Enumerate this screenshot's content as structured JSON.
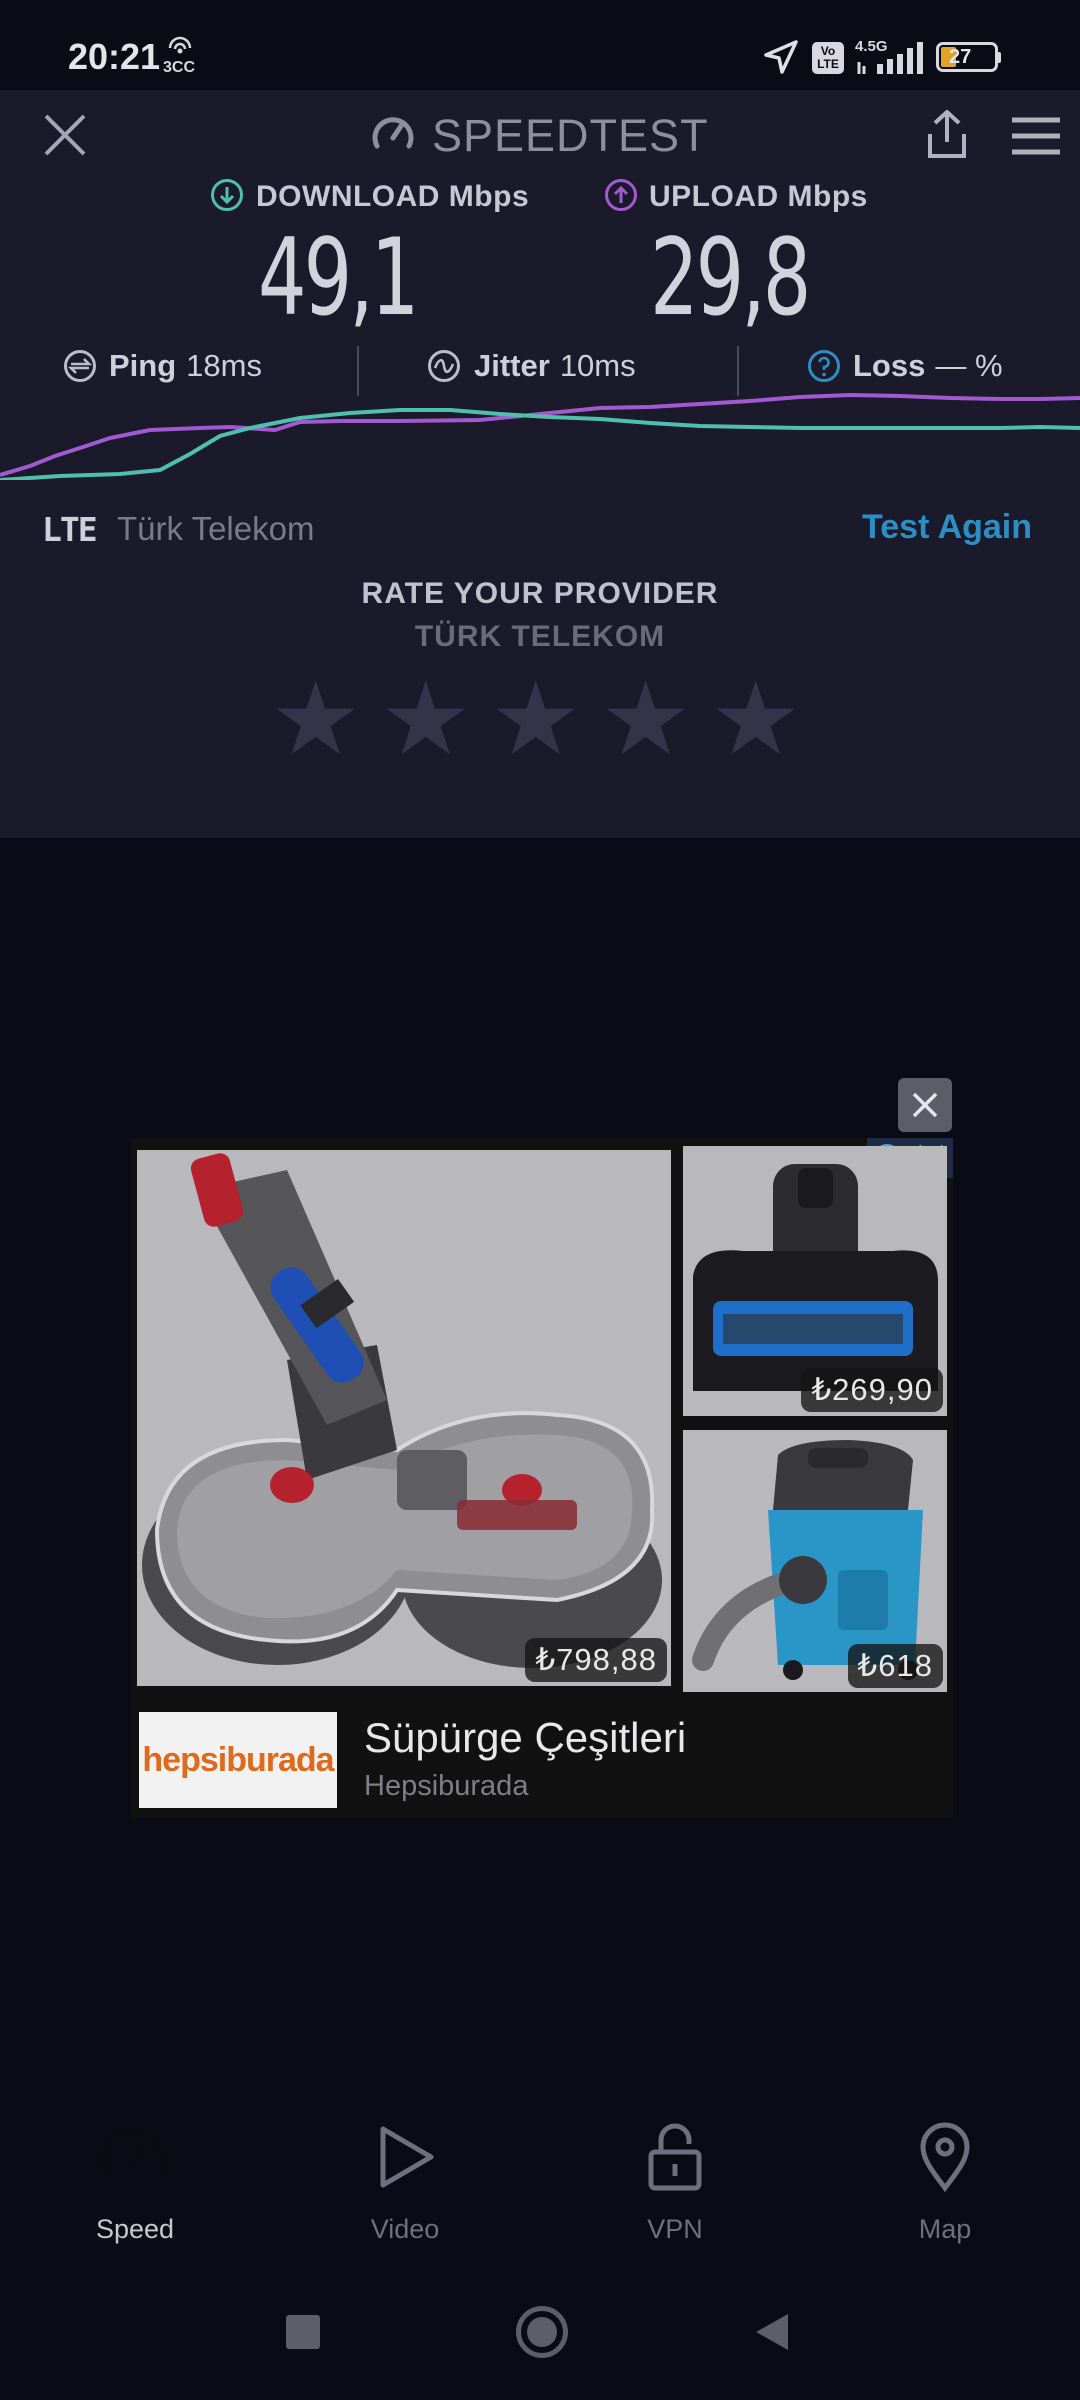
{
  "status_bar": {
    "time": "20:21",
    "left_icon_label": "3CC",
    "network_label": "4.5G",
    "volte_label": "Vo LTE",
    "battery_level": "27"
  },
  "header": {
    "title": "SPEEDTEST"
  },
  "metrics": {
    "download_label": "DOWNLOAD Mbps",
    "download_value": "49,1",
    "upload_label": "UPLOAD Mbps",
    "upload_value": "29,8"
  },
  "stats": {
    "ping_label": "Ping",
    "ping_value": "18ms",
    "jitter_label": "Jitter",
    "jitter_value": "10ms",
    "loss_label": "Loss",
    "loss_value": "— %"
  },
  "connection": {
    "type": "LTE",
    "provider": "Türk Telekom",
    "test_again": "Test Again"
  },
  "rating": {
    "title": "RATE YOUR PROVIDER",
    "provider": "TÜRK TELEKOM",
    "stars_filled": 0,
    "stars_total": 5
  },
  "ad": {
    "price_main": "₺798,88",
    "price_top_right": "₺269,90",
    "price_bottom_right": "₺618",
    "brand_logo_text": "hepsiburada",
    "headline": "Süpürge Çeşitleri",
    "advertiser": "Hepsiburada"
  },
  "bottom_nav": {
    "items": [
      {
        "label": "Speed",
        "icon": "speedometer-icon",
        "active": true
      },
      {
        "label": "Video",
        "icon": "play-icon",
        "active": false
      },
      {
        "label": "VPN",
        "icon": "lock-icon",
        "active": false
      },
      {
        "label": "Map",
        "icon": "map-pin-icon",
        "active": false
      }
    ]
  },
  "colors": {
    "download": "#4fbfae",
    "upload": "#a35ad1",
    "accent": "#2c8ec7",
    "panel_bg": "#1a1a2b",
    "page_bg": "#0b0b16"
  }
}
